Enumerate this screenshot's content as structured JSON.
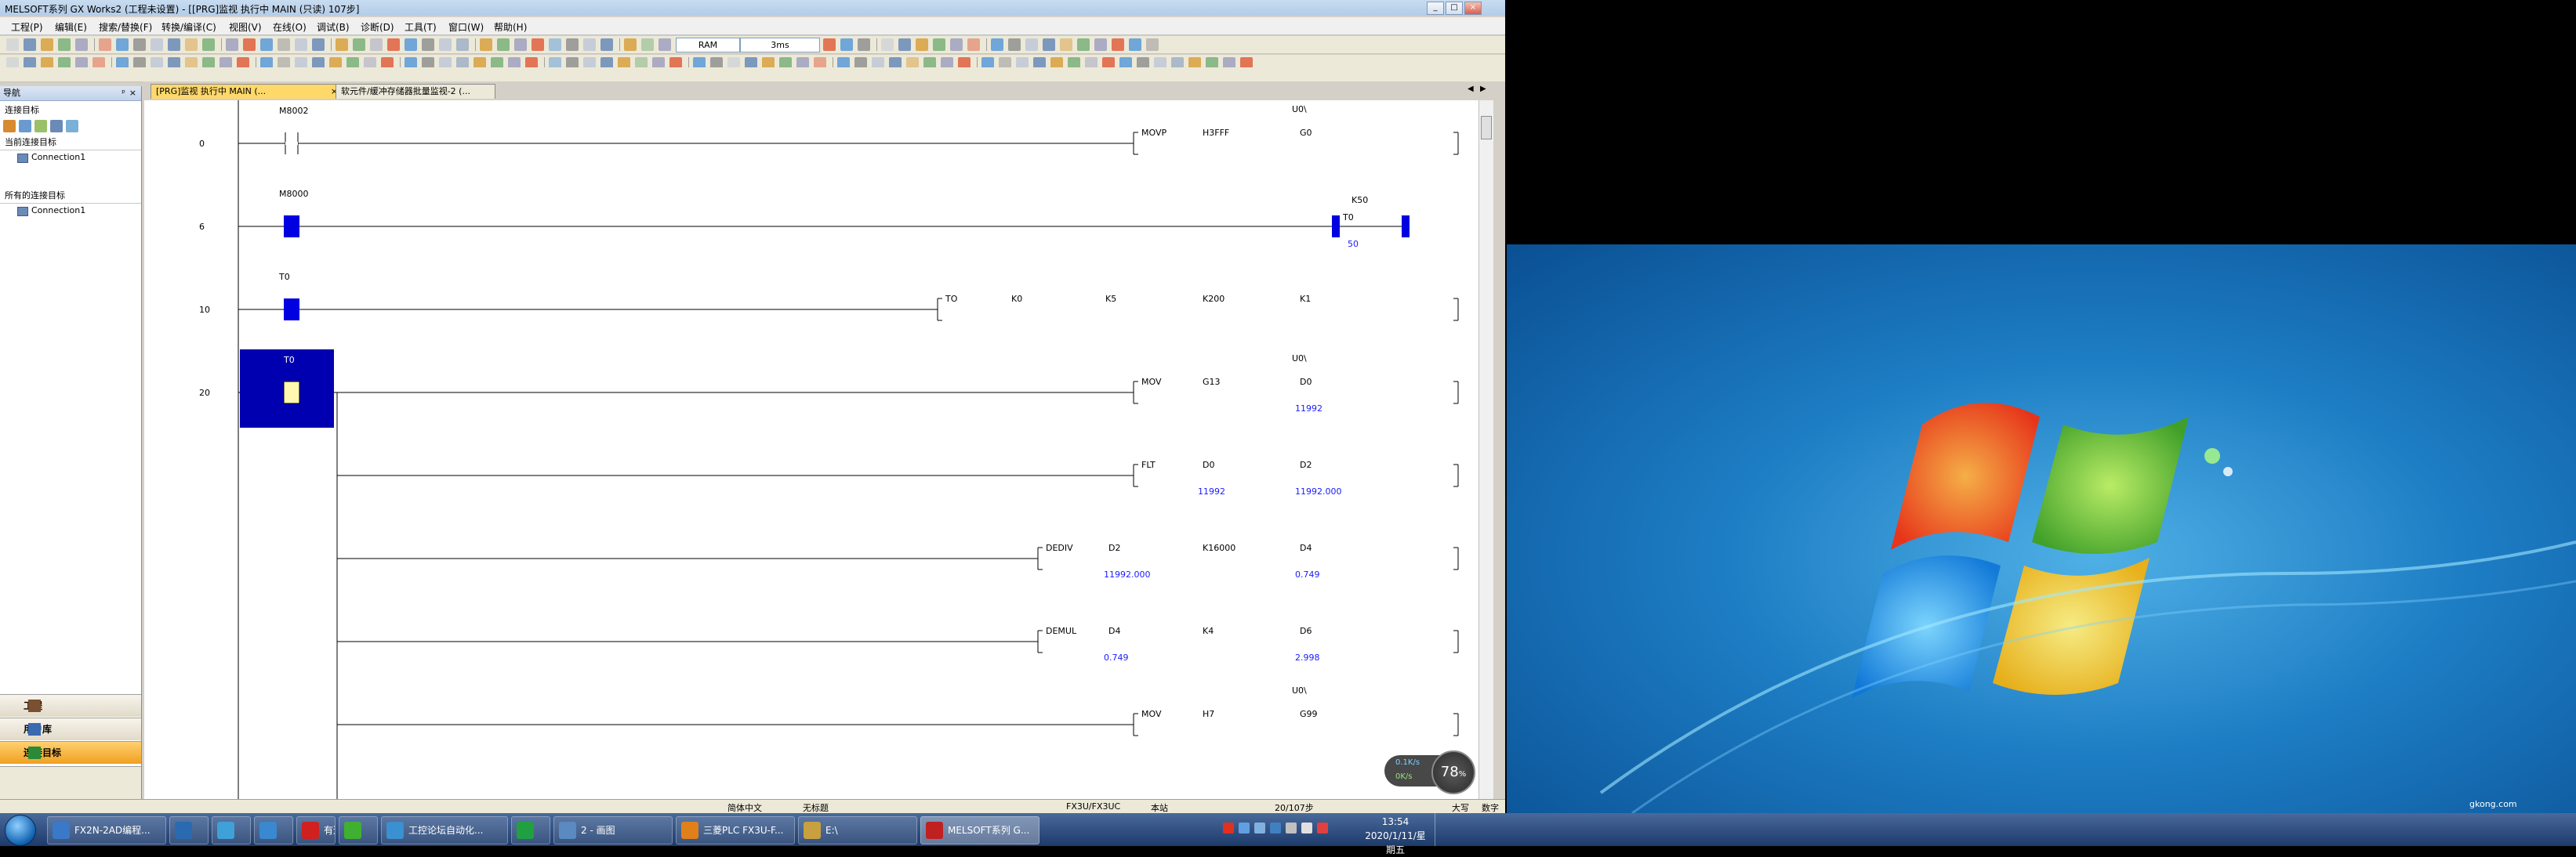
{
  "window": {
    "title": "MELSOFT系列 GX Works2 (工程未设置) - [[PRG]监视 执行中 MAIN (只读) 107步]",
    "controls": [
      "_",
      "□",
      "×"
    ]
  },
  "menu": [
    "工程(P)",
    "编辑(E)",
    "搜索/替换(F)",
    "转换/编译(C)",
    "视图(V)",
    "在线(O)",
    "调试(B)",
    "诊断(D)",
    "工具(T)",
    "窗口(W)",
    "帮助(H)"
  ],
  "toolbar": {
    "memory": "RAM",
    "scan_time": "3ms"
  },
  "nav": {
    "header": "导航",
    "pin": "ᵖ",
    "close": "×",
    "connect_target_label": "连接目标",
    "current_section": "当前连接目标",
    "current_item": "Connection1",
    "all_section": "所有的连接目标",
    "all_item": "Connection1",
    "buttons": [
      {
        "label": "工程",
        "color": "#7a5030"
      },
      {
        "label": "用户库",
        "color": "#3a6ab0"
      },
      {
        "label": "连接目标",
        "color": "#2a8a3a"
      }
    ]
  },
  "tabs": [
    {
      "label": "[PRG]监视 执行中 MAIN (...",
      "active": true
    },
    {
      "label": "软元件/缓冲存储器批量监视-2 (...",
      "active": false
    }
  ],
  "ladder": {
    "rungs": [
      {
        "step": "0",
        "contact": {
          "label": "M8002",
          "state": "off"
        },
        "instruction": {
          "op": "MOVP",
          "args": [
            "H3FFF",
            "G0"
          ],
          "prefix": "U0\\",
          "values": [
            "",
            ""
          ]
        }
      },
      {
        "step": "6",
        "contact": {
          "label": "M8000",
          "state": "on"
        },
        "coil": {
          "label": "T0",
          "setting": "K50",
          "value": "50"
        }
      },
      {
        "step": "10",
        "contact": {
          "label": "T0",
          "state": "on"
        },
        "instruction": {
          "op": "TO",
          "args": [
            "K0",
            "K5",
            "K200",
            "K1"
          ]
        }
      },
      {
        "step": "20",
        "contact": {
          "label": "T0",
          "state": "selected"
        },
        "instruction": {
          "op": "MOV",
          "args": [
            "G13",
            "D0"
          ],
          "prefix": "U0\\",
          "values": [
            "",
            "11992"
          ]
        }
      },
      {
        "step": "",
        "instruction": {
          "op": "FLT",
          "args": [
            "D0",
            "D2"
          ],
          "values": [
            "11992",
            "11992.000"
          ]
        }
      },
      {
        "step": "",
        "instruction": {
          "op": "DEDIV",
          "args": [
            "D2",
            "K16000",
            "D4"
          ],
          "values": [
            "11992.000",
            "",
            "0.749"
          ]
        }
      },
      {
        "step": "",
        "instruction": {
          "op": "DEMUL",
          "args": [
            "D4",
            "K4",
            "D6"
          ],
          "values": [
            "0.749",
            "",
            "2.998"
          ]
        }
      },
      {
        "step": "",
        "instruction": {
          "op": "MOV",
          "args": [
            "H7",
            "G99"
          ],
          "prefix": "U0\\",
          "values": [
            "",
            ""
          ]
        }
      }
    ]
  },
  "status": {
    "lang": "简体中文",
    "title": "无标题",
    "cpu": "FX3U/FX3UC",
    "station": "本站",
    "steps": "20/107步",
    "caps": "大写",
    "num": "数字"
  },
  "widget": {
    "up": "0.1K/s",
    "down": "0K/s",
    "percent": "78",
    "unit": "%"
  },
  "taskbar": {
    "tasks": [
      {
        "label": "FX2N-2AD编程...",
        "color": "#3a78c8",
        "active": false
      },
      {
        "label": "",
        "color": "#2a6ab0",
        "active": false
      },
      {
        "label": "",
        "color": "#40a0d8",
        "active": false
      },
      {
        "label": "",
        "color": "#3a88d0",
        "active": false
      },
      {
        "label": "有道",
        "color": "#d02020",
        "active": false
      },
      {
        "label": "",
        "color": "#40b030",
        "active": false
      },
      {
        "label": "工控论坛自动化...",
        "color": "#3a90d0",
        "active": false
      },
      {
        "label": "",
        "color": "#20a040",
        "active": false
      },
      {
        "label": "2 - 画图",
        "color": "#5a8ac0",
        "active": false
      },
      {
        "label": "三菱PLC FX3U-F...",
        "color": "#e0801a",
        "active": false
      },
      {
        "label": "E:\\",
        "color": "#c8a040",
        "active": false
      },
      {
        "label": "MELSOFT系列 G...",
        "color": "#c02020",
        "active": true
      }
    ],
    "time": "13:54",
    "date": "2020/1/11/星期五"
  },
  "watermark": "gkong.com",
  "colors": {
    "value_blue": "#1a1aff",
    "select_blue": "#0000b0",
    "contact_on": "#0000e0"
  }
}
